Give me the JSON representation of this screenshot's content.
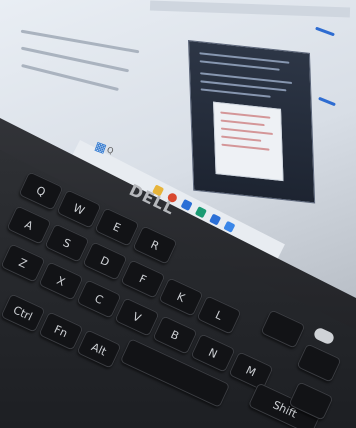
{
  "photo": {
    "brand_logo": "DELL",
    "taskbar_search": "Q",
    "key_labels": [
      "Q",
      "W",
      "E",
      "R",
      "A",
      "S",
      "D",
      "F",
      "Z",
      "X",
      "C",
      "V",
      "B",
      "N",
      "M",
      "K",
      "L",
      "Ctrl",
      "Fn",
      "Alt",
      "Shift"
    ],
    "colors": {
      "screen": "#e2e7ee",
      "keyboard": "#1d1f23",
      "keycap": "#121316",
      "window": "#1d2431"
    }
  }
}
